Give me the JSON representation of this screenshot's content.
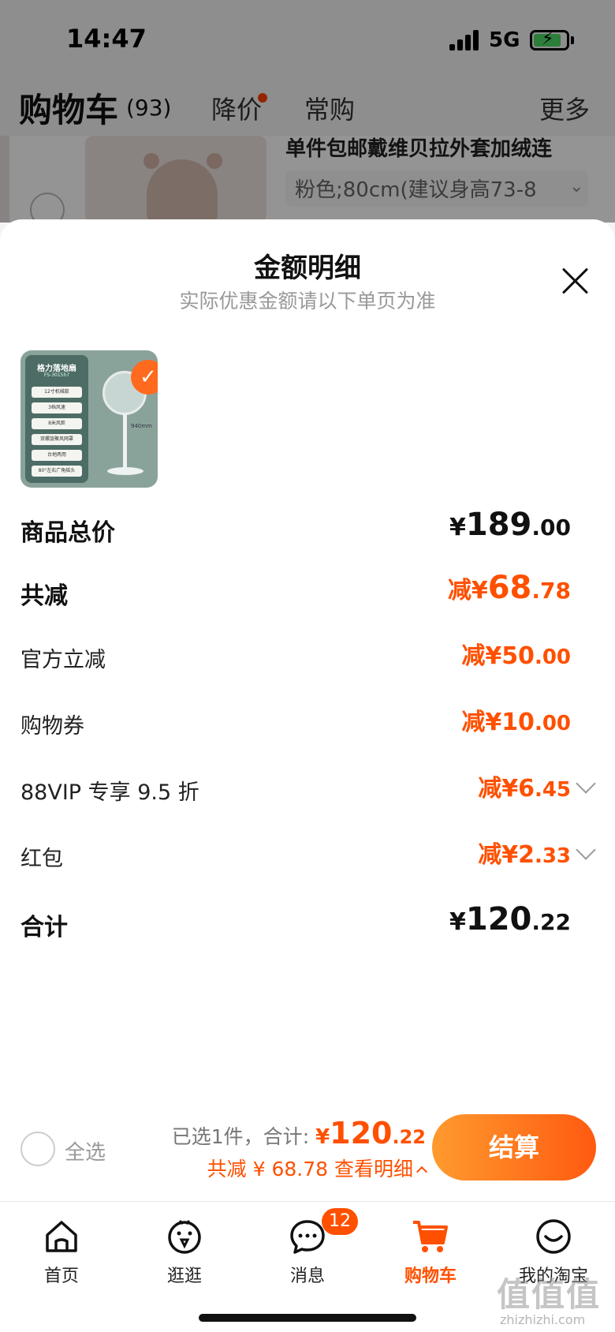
{
  "status_bar": {
    "time": "14:47",
    "network": "5G"
  },
  "background": {
    "cart_title": "购物车",
    "cart_count": "(93)",
    "tabs": [
      {
        "label": "降价"
      },
      {
        "label": "常购"
      }
    ],
    "more": "更多",
    "product_name": "单件包邮戴维贝拉外套加绒连",
    "product_spec": "粉色;80cm(建议身高73-8"
  },
  "sheet": {
    "title": "金额明细",
    "subtitle": "实际优惠金额请以下单页为准",
    "product_image": {
      "panel_title": "格力落地扇",
      "panel_model": "FS-3015h7",
      "features": [
        "12寸机械款",
        "3档风速",
        "8米风距",
        "双螺旋聚风网罩",
        "台地两用",
        "80°左右广角摇头"
      ],
      "dimension": "940mm"
    },
    "rows": [
      {
        "label": "商品总价",
        "prefix": "",
        "symbol": "¥",
        "int": "189",
        "dec": ".00"
      },
      {
        "label": "共减",
        "prefix": "减",
        "symbol": "¥",
        "int": "68",
        "dec": ".78"
      },
      {
        "label": "官方立减",
        "prefix": "减",
        "symbol": "¥",
        "int": "50",
        "dec": ".00"
      },
      {
        "label": "购物券",
        "prefix": "减",
        "symbol": "¥",
        "int": "10",
        "dec": ".00"
      },
      {
        "label": "88VIP 专享 9.5 折",
        "prefix": "减",
        "symbol": "¥",
        "int": "6",
        "dec": ".45"
      },
      {
        "label": "红包",
        "prefix": "减",
        "symbol": "¥",
        "int": "2",
        "dec": ".33"
      },
      {
        "label": "合计",
        "prefix": "",
        "symbol": "¥",
        "int": "120",
        "dec": ".22"
      }
    ]
  },
  "checkout": {
    "select_all": "全选",
    "selected_text": "已选1件，合计: ",
    "total_symbol": "¥",
    "total_int": "120",
    "total_dec": ".22",
    "savings_text": "共减 ¥ 68.78  查看明细",
    "button": "结算"
  },
  "tabbar": {
    "items": [
      {
        "label": "首页"
      },
      {
        "label": "逛逛"
      },
      {
        "label": "消息",
        "badge": "12"
      },
      {
        "label": "购物车"
      },
      {
        "label": "我的淘宝"
      }
    ]
  },
  "watermark": {
    "glyphs": "值值值",
    "url": "zhizhizhi.com"
  },
  "colors": {
    "accent": "#ff5000",
    "button_start": "#ff9a2e",
    "button_end": "#ff5a10"
  }
}
